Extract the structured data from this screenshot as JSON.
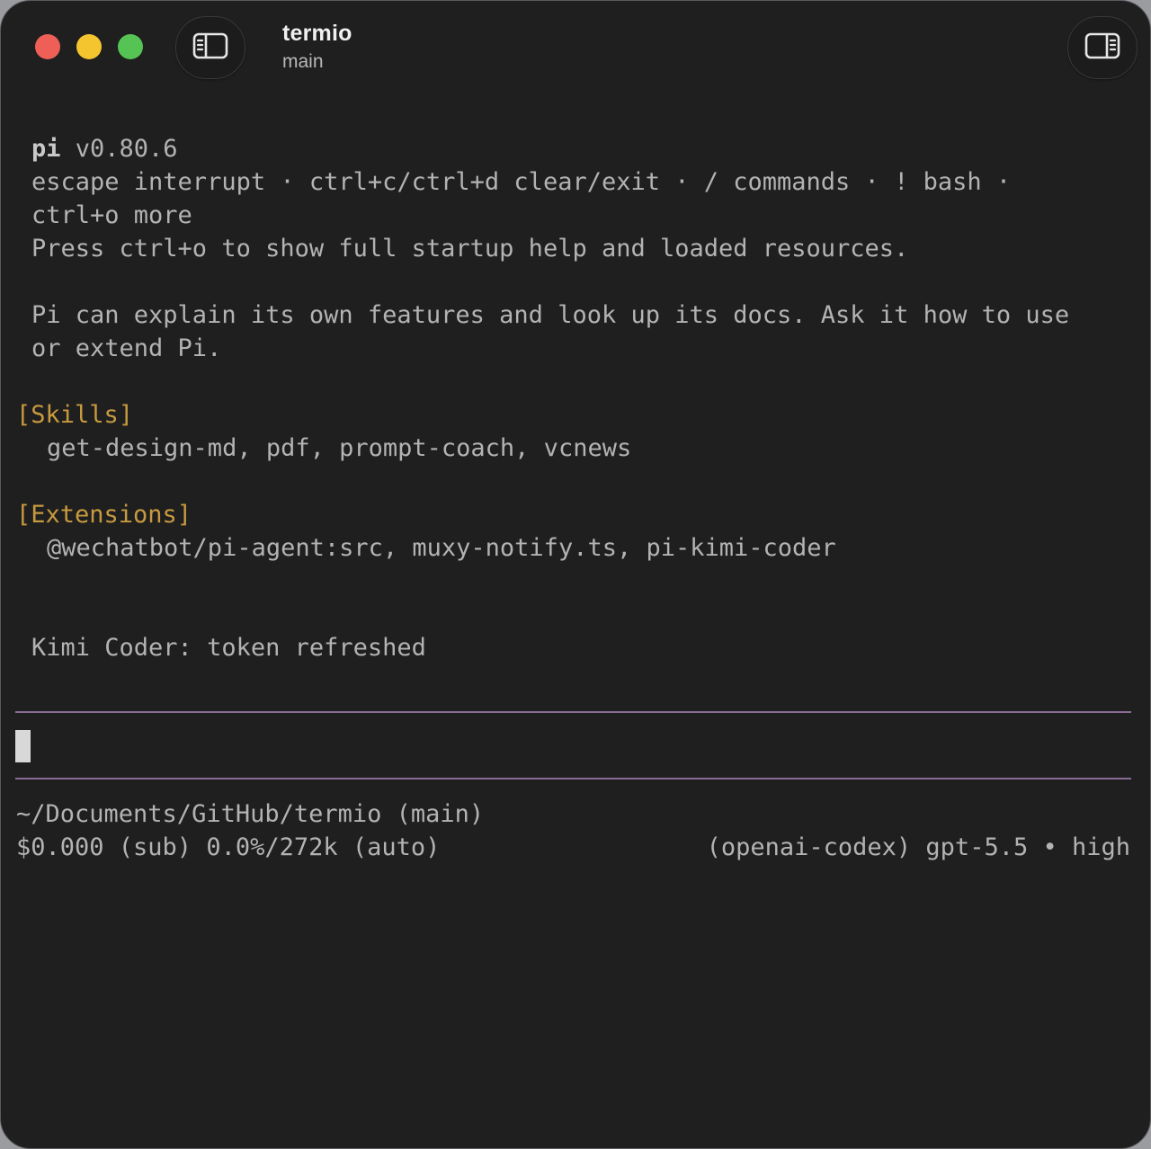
{
  "window": {
    "title": "termio",
    "subtitle": "main"
  },
  "icons": {
    "left_toggle": "sidebar-left-icon",
    "right_toggle": "sidebar-right-icon"
  },
  "terminal": {
    "header": {
      "name": "pi",
      "version": " v0.80.6"
    },
    "help_line_1": "escape interrupt · ctrl+c/ctrl+d clear/exit · / commands · ! bash ·",
    "help_line_2": "ctrl+o more",
    "help_line_3": "Press ctrl+o to show full startup help and loaded resources.",
    "intro_line_1": "Pi can explain its own features and look up its docs. Ask it how to use",
    "intro_line_2": "or extend Pi.",
    "skills_heading": "[Skills]",
    "skills_list": "get-design-md, pdf, prompt-coach, vcnews",
    "extensions_heading": "[Extensions]",
    "extensions_list": "@wechatbot/pi-agent:src, muxy-notify.ts, pi-kimi-coder",
    "notice": "Kimi Coder: token refreshed",
    "input_value": "",
    "status_path": "~/Documents/GitHub/termio (main)",
    "status_usage": "$0.000 (sub) 0.0%/272k (auto)",
    "status_model": "(openai-codex) gpt-5.5 • high"
  },
  "colors": {
    "background": "#1f1f1f",
    "text": "#b3b3b3",
    "heading": "#c79a3f",
    "separator": "#8a6c96",
    "close": "#ee5f57",
    "minimize": "#f5c52f",
    "zoom": "#56c454"
  }
}
